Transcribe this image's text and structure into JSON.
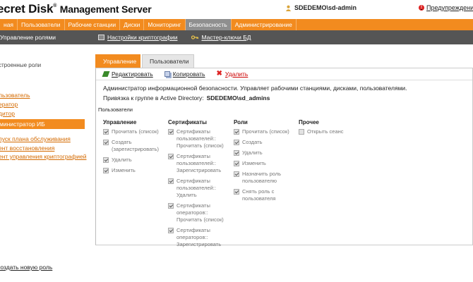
{
  "header": {
    "logo_main": "ecret Disk",
    "logo_reg": "®",
    "logo_sub": "Management Server",
    "user": "SDEDEMO\\sd-admin",
    "warnings": "Предупреждения"
  },
  "nav": {
    "tabs": [
      {
        "label": "ная",
        "active": false
      },
      {
        "label": "Пользователи",
        "active": false
      },
      {
        "label": "Рабочие станции",
        "active": false
      },
      {
        "label": "Диски",
        "active": false
      },
      {
        "label": "Мониторинг",
        "active": false
      },
      {
        "label": "Безопасность",
        "active": true
      },
      {
        "label": "Администрирование",
        "active": false
      }
    ]
  },
  "subnav": {
    "manage_roles": "Управление ролями",
    "crypto_settings": "Настройки криптографии",
    "master_keys": "Мастер-ключи БД"
  },
  "sidebar": {
    "title": "строенные роли",
    "builtin": [
      "льзователь",
      "ератор",
      "дитор"
    ],
    "active": "министратор ИБ",
    "custom": [
      "пуск плана обслуживания",
      "ент восстановления",
      "ент управления криптографией"
    ],
    "create_role": "создать новую роль"
  },
  "panel": {
    "tabs": [
      "Управление",
      "Пользователи"
    ],
    "toolbar": {
      "edit": "Редактировать",
      "copy": "Копировать",
      "delete": "Удалить"
    },
    "description": "Администратор информационной безопасности. Управляет рабочими станциями, дисками, пользователями.",
    "ad_label": "Привязка к группе в Active Directory:",
    "ad_value": "SDEDEMO\\sd_admins",
    "users_label": "Пользователи",
    "columns": [
      {
        "header": "Управление",
        "items": [
          {
            "label": "Прочитать (список)",
            "checked": true
          },
          {
            "label": "Создать\n(зарегистрировать)",
            "checked": true
          },
          {
            "label": "Удалить",
            "checked": true
          },
          {
            "label": "Изменить",
            "checked": true
          }
        ]
      },
      {
        "header": "Сертификаты",
        "items": [
          {
            "label": "Сертификаты\nпользователей::\nПрочитать (список)",
            "checked": true
          },
          {
            "label": "Сертификаты\nпользователей::\nЗарегистрировать",
            "checked": true
          },
          {
            "label": "Сертификаты\nпользователей::\nУдалить",
            "checked": true
          },
          {
            "label": "Сертификаты\nоператоров::\nПрочитать (список)",
            "checked": true
          },
          {
            "label": "Сертификаты\nоператоров::\nЗарегистрировать",
            "checked": true
          }
        ]
      },
      {
        "header": "Роли",
        "items": [
          {
            "label": "Прочитать (список)",
            "checked": true
          },
          {
            "label": "Создать",
            "checked": true
          },
          {
            "label": "Удалить",
            "checked": true
          },
          {
            "label": "Изменить",
            "checked": true
          },
          {
            "label": "Назначить роль\nпользователю",
            "checked": true
          },
          {
            "label": "Снять роль с\nпользователя",
            "checked": true
          }
        ]
      },
      {
        "header": "Прочее",
        "items": [
          {
            "label": "Открыть сеанс",
            "checked": false
          }
        ]
      }
    ]
  }
}
